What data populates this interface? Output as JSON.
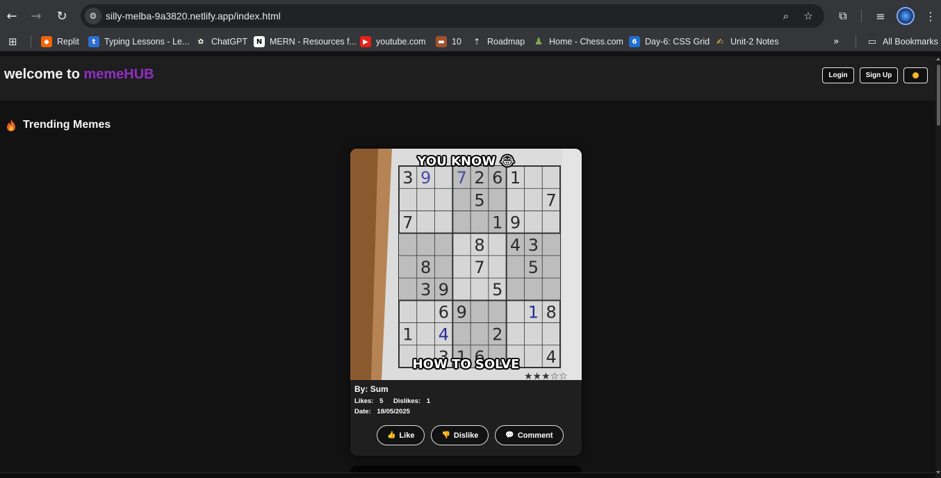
{
  "browser": {
    "url": "silly-melba-9a3820.netlify.app/index.html",
    "bookmarks": [
      {
        "label": "Replit",
        "icon": "replit-icon",
        "color": "#f26207"
      },
      {
        "label": "Typing Lessons - Le...",
        "icon": "typing-icon",
        "color": "#2d6ed3"
      },
      {
        "label": "ChatGPT",
        "icon": "chatgpt-icon",
        "color": "#444"
      },
      {
        "label": "MERN - Resources f...",
        "icon": "notion-icon",
        "color": "#111"
      },
      {
        "label": "youtube.com",
        "icon": "youtube-icon",
        "color": "#e62117"
      },
      {
        "label": "10",
        "icon": "briefcase-icon",
        "color": "#a0522d"
      },
      {
        "label": "Roadmap",
        "icon": "rocket-icon",
        "color": "#8a8a8a"
      },
      {
        "label": "Home - Chess.com",
        "icon": "chess-icon",
        "color": "#7fa650"
      },
      {
        "label": "Day-6: CSS Grid",
        "icon": "day6-icon",
        "color": "#1f6fd1"
      },
      {
        "label": "Unit-2 Notes",
        "icon": "notes-icon",
        "color": "#f0c040"
      }
    ],
    "all_bookmarks": "All Bookmarks"
  },
  "header": {
    "brand_prefix": "welcome to",
    "brand_accent": "memeHUB",
    "login": "Login",
    "signup": "Sign Up"
  },
  "section": {
    "title": "Trending Memes"
  },
  "meme": {
    "caption_top": "YOU KNOW 😂",
    "caption_bottom": "HOW TO SOLVE",
    "by_label": "By:",
    "author": "Sum",
    "likes_label": "Likes:",
    "likes": "5",
    "dislikes_label": "Dislikes:",
    "dislikes": "1",
    "date_label": "Date:",
    "date": "18/05/2025",
    "like": "Like",
    "dislike": "Dislike",
    "comment": "Comment"
  },
  "colors": {
    "accent": "#8e2fc2",
    "page_bg": "#121212",
    "header_bg": "#1e1e1e"
  }
}
